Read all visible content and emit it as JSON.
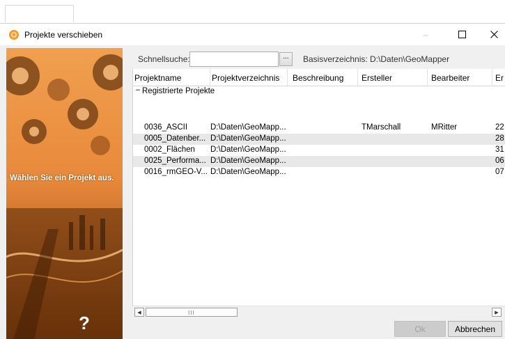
{
  "window": {
    "title": "Projekte verschieben",
    "minimize_glyph": "–",
    "maximize_glyph": "☐",
    "close_glyph": "✕"
  },
  "banner": {
    "text": "Wählen Sie ein Projekt aus.",
    "help_glyph": "?"
  },
  "search": {
    "label": "Schnellsuche:",
    "value": "",
    "placeholder": "",
    "browse_button": "...",
    "basedir_text": "Basisverzeichnis: D:\\Daten\\GeoMapper"
  },
  "grid": {
    "columns": [
      "Projektname",
      "Projektverzeichnis",
      "Beschreibung",
      "Ersteller",
      "Bearbeiter",
      "Er"
    ],
    "group": {
      "toggle": "−",
      "label": "Registrierte Projekte"
    },
    "rows": [
      [
        "0036_ASCII",
        "D:\\Daten\\GeoMapp...",
        "",
        "TMarschall",
        "MRitter",
        "22"
      ],
      [
        "0005_Datenber...",
        "D:\\Daten\\GeoMapp...",
        "",
        "",
        "",
        "28"
      ],
      [
        "0002_Flächen",
        "D:\\Daten\\GeoMapp...",
        "",
        "",
        "",
        "31"
      ],
      [
        "0025_Performa...",
        "D:\\Daten\\GeoMapp...",
        "",
        "",
        "",
        "06"
      ],
      [
        "0016_rmGEO-V...",
        "D:\\Daten\\GeoMapp...",
        "",
        "",
        "",
        "07"
      ]
    ]
  },
  "scrollbar": {
    "left_arrow": "◀",
    "right_arrow": "▶",
    "grip": "III"
  },
  "buttons": {
    "ok": "Ok",
    "cancel": "Abbrechen"
  },
  "colors": {
    "banner_orange": "#e8893a",
    "accent_icon": "#f29a2e"
  }
}
